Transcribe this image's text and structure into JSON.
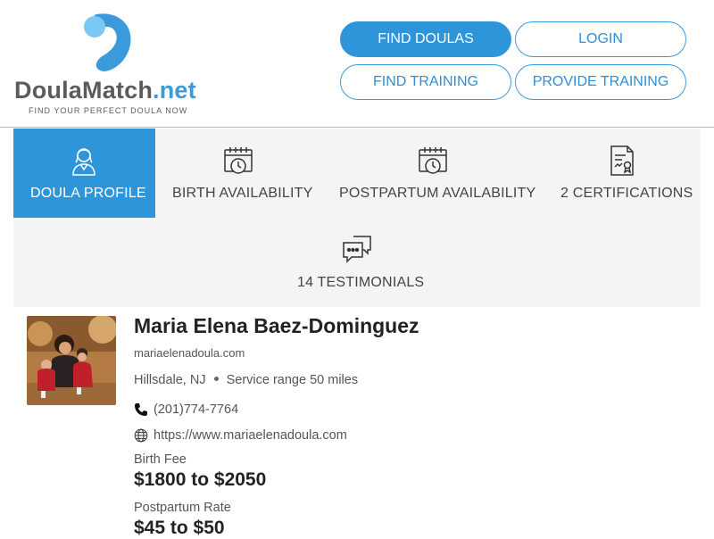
{
  "header": {
    "logo": {
      "brand": "DoulaMatch",
      "tld": ".net",
      "tagline": "FIND YOUR PERFECT DOULA NOW"
    },
    "nav": {
      "find_doulas": "FIND DOULAS",
      "login": "LOGIN",
      "find_training": "FIND TRAINING",
      "provide_training": "PROVIDE TRAINING"
    }
  },
  "tabs": [
    {
      "label": "DOULA PROFILE",
      "icon": "doula-profile-icon",
      "active": true
    },
    {
      "label": "BIRTH AVAILABILITY",
      "icon": "calendar-clock-icon",
      "active": false
    },
    {
      "label": "POSTPARTUM AVAILABILITY",
      "icon": "calendar-clock-icon",
      "active": false
    },
    {
      "label": "2 CERTIFICATIONS",
      "icon": "certificate-icon",
      "active": false
    },
    {
      "label": "14 TESTIMONIALS",
      "icon": "chat-bubbles-icon",
      "active": false
    }
  ],
  "profile": {
    "name": "Maria Elena Baez-Dominguez",
    "website_short": "mariaelenadoula.com",
    "city": "Hillsdale, NJ",
    "service_range": "Service range 50 miles",
    "phone": "(201)774-7764",
    "website_url": "https://www.mariaelenadoula.com",
    "birth_fee_label": "Birth Fee",
    "birth_fee": "$1800 to $2050",
    "postpartum_label": "Postpartum Rate",
    "postpartum_rate": "$45 to $50"
  },
  "colors": {
    "accent": "#2f95db",
    "tab_bg": "#f4f4f4",
    "text_dark": "#222222"
  }
}
